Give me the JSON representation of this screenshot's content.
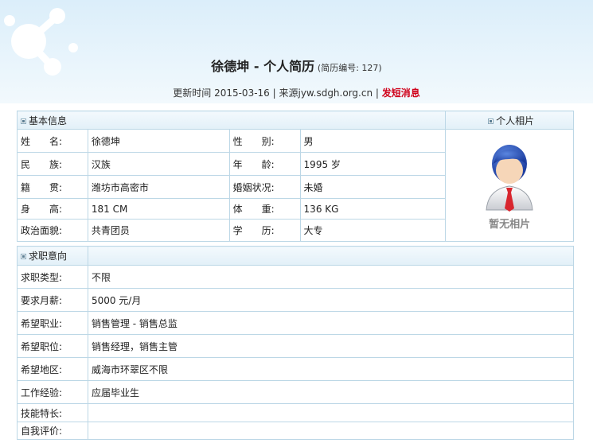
{
  "header": {
    "name": "徐德坤",
    "title_sep": " - ",
    "title": "个人简历",
    "resume_no_prefix": "(简历编号: ",
    "resume_no": "127",
    "resume_no_suffix": ")",
    "update_label": "更新时间 ",
    "update_date": "2015-03-16",
    "sep1": " | ",
    "source": "来源jyw.sdgh.org.cn",
    "sep2": " | ",
    "send_message": "发短消息"
  },
  "basic": {
    "section_title": "基本信息",
    "photo_title": "个人相片",
    "no_photo": "暂无相片",
    "rows": [
      {
        "l1": "姓　　名:",
        "v1": "徐德坤",
        "l2": "性　　别:",
        "v2": "男"
      },
      {
        "l1": "民　　族:",
        "v1": "汉族",
        "l2": "年　　龄:",
        "v2": "1995 岁"
      },
      {
        "l1": "籍　　贯:",
        "v1": "潍坊市高密市",
        "l2": "婚姻状况:",
        "v2": "未婚"
      },
      {
        "l1": "身　　高:",
        "v1": "181 CM",
        "l2": "体　　重:",
        "v2": "136 KG"
      },
      {
        "l1": "政治面貌:",
        "v1": "共青团员",
        "l2": "学　　历:",
        "v2": "大专"
      }
    ]
  },
  "intent": {
    "section_title": "求职意向",
    "rows": [
      {
        "label": "求职类型:",
        "value": "不限"
      },
      {
        "label": "要求月薪:",
        "value": "5000 元/月"
      },
      {
        "label": "希望职业:",
        "value": "销售管理 - 销售总监"
      },
      {
        "label": "希望职位:",
        "value": "销售经理，销售主管"
      },
      {
        "label": "希望地区:",
        "value": "威海市环翠区不限"
      },
      {
        "label": "工作经验:",
        "value": "应届毕业生"
      },
      {
        "label": "技能特长:",
        "value": ""
      },
      {
        "label": "自我评价:",
        "value": ""
      }
    ]
  }
}
